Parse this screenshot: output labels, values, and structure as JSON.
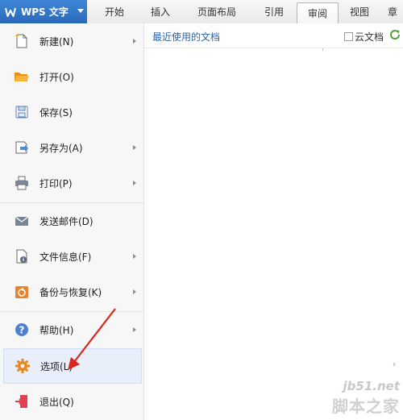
{
  "app": {
    "name": "WPS 文字",
    "accent_color": "#2f74c8"
  },
  "tabs": [
    {
      "label": "开始"
    },
    {
      "label": "插入"
    },
    {
      "label": "页面布局"
    },
    {
      "label": "引用"
    },
    {
      "label": "审阅",
      "active": true
    },
    {
      "label": "视图"
    },
    {
      "label": "章"
    }
  ],
  "menu": {
    "items": [
      {
        "label": "新建(N)",
        "icon": "new-document-icon",
        "submenu": true
      },
      {
        "label": "打开(O)",
        "icon": "open-folder-icon",
        "submenu": false
      },
      {
        "label": "保存(S)",
        "icon": "save-icon",
        "submenu": false
      },
      {
        "label": "另存为(A)",
        "icon": "save-as-icon",
        "submenu": true
      },
      {
        "label": "打印(P)",
        "icon": "printer-icon",
        "submenu": true
      },
      {
        "label": "发送邮件(D)",
        "icon": "mail-icon",
        "submenu": false
      },
      {
        "label": "文件信息(F)",
        "icon": "file-info-icon",
        "submenu": true
      },
      {
        "label": "备份与恢复(K)",
        "icon": "backup-icon",
        "submenu": true
      },
      {
        "label": "帮助(H)",
        "icon": "help-icon",
        "submenu": true
      },
      {
        "label": "选项(L)",
        "icon": "gear-icon",
        "submenu": false,
        "highlighted": true
      },
      {
        "label": "退出(Q)",
        "icon": "exit-icon",
        "submenu": false
      }
    ]
  },
  "recent": {
    "title": "最近使用的文档",
    "cloud_docs_label": "云文档",
    "cloud_docs_checked": false
  },
  "watermark": {
    "site": "jb51.net",
    "name": "脚本之家"
  },
  "annotation": {
    "arrow_color": "#d9261c"
  }
}
